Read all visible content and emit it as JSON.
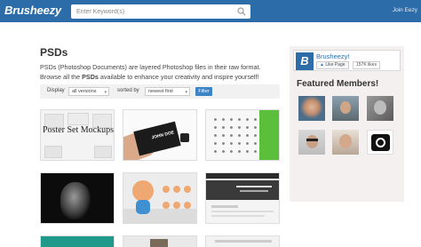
{
  "header": {
    "logo": "Brusheezy",
    "search_placeholder": "Enter Keyword(s)",
    "join_label": "Join Eezy",
    "bar_color": "#2c6ca9"
  },
  "page": {
    "title": "PSDs",
    "description_prefix": "PSDs (Photoshop Documents) are layered Photoshop files in their raw format. Browse all the ",
    "description_bold": "PSDs",
    "description_suffix": " available to enhance your creativity and inspire yourself!"
  },
  "filters": {
    "display_label": "Display",
    "display_value": "all versions",
    "sort_label": "sorted by",
    "sort_value": "newest first",
    "filter_button": "Filter"
  },
  "thumbnails": [
    {
      "name": "poster-set-mockups",
      "text": "Poster Set Mockups"
    },
    {
      "name": "business-card-hand",
      "text": "JOHN DOE"
    },
    {
      "name": "icon-grid-green",
      "text": ""
    },
    {
      "name": "dark-portrait",
      "text": ""
    },
    {
      "name": "cartoon-baby",
      "text": ""
    },
    {
      "name": "website-template",
      "text": ""
    },
    {
      "name": "teal-thumb",
      "text": ""
    },
    {
      "name": "photo-thumb",
      "text": ""
    },
    {
      "name": "layout-thumb",
      "text": ""
    }
  ],
  "sidebar": {
    "fb_name": "Brusheezy!",
    "fb_like": "Like Page",
    "fb_count": "157K likes",
    "featured_title": "Featured Members!"
  },
  "icons": {
    "search": "search-icon",
    "facebook_like": "thumbs-up-icon"
  }
}
